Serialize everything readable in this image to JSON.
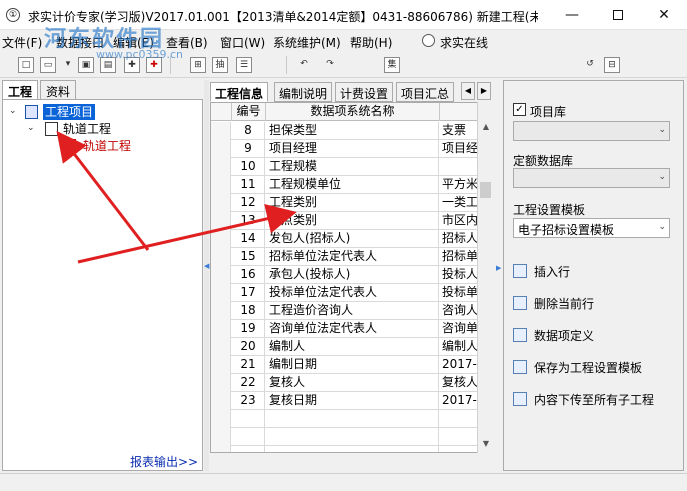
{
  "window": {
    "title": "求实计价专家(学习版)V2017.01.001【2013清单&2014定额】0431-88606786) 新建工程(未...",
    "app_icon": "①"
  },
  "watermark": {
    "text": "河东软件园",
    "url": "www.pc0359.cn"
  },
  "menu": [
    "文件(F)",
    "数据接口",
    "编辑(E)",
    "查看(B)",
    "窗口(W)",
    "系统维护(M)",
    "帮助(H)"
  ],
  "online": {
    "label": "求实在线"
  },
  "toolbar": {
    "b1": "□",
    "b2": "▭",
    "b3": "▾",
    "b4": "▣",
    "b5": "▤",
    "b6": "✚",
    "b7": "⊞",
    "b8": "抽",
    "b9": "☰",
    "b10": "↶",
    "b11": "↷",
    "b12": "集",
    "b13": "↺",
    "b14": "⊟"
  },
  "left_tabs": [
    "工程",
    "资料"
  ],
  "tree": {
    "root": "工程项目",
    "child": "轨道工程",
    "leaf": "轨道工程",
    "toggle_open": "⌄"
  },
  "report_link": "报表输出>>",
  "mid_tabs": [
    "工程信息",
    "编制说明",
    "计费设置",
    "项目汇总"
  ],
  "tab_scroll": {
    "left": "◀",
    "right": "▶"
  },
  "grid": {
    "headers": [
      "编号",
      "数据项系统名称",
      ""
    ],
    "rows": [
      {
        "num": "8",
        "name": "担保类型",
        "val": "支票"
      },
      {
        "num": "9",
        "name": "项目经理",
        "val": "项目经"
      },
      {
        "num": "10",
        "name": "工程规模",
        "val": ""
      },
      {
        "num": "11",
        "name": "工程规模单位",
        "val": "平方米"
      },
      {
        "num": "12",
        "name": "工程类别",
        "val": "一类工"
      },
      {
        "num": "13",
        "name": "地点类别",
        "val": "市区内"
      },
      {
        "num": "14",
        "name": "发包人(招标人)",
        "val": "招标人"
      },
      {
        "num": "15",
        "name": "招标单位法定代表人",
        "val": "招标单"
      },
      {
        "num": "16",
        "name": "承包人(投标人)",
        "val": "投标人"
      },
      {
        "num": "17",
        "name": "投标单位法定代表人",
        "val": "投标单"
      },
      {
        "num": "18",
        "name": "工程造价咨询人",
        "val": "咨询人"
      },
      {
        "num": "19",
        "name": "咨询单位法定代表人",
        "val": "咨询单"
      },
      {
        "num": "20",
        "name": "编制人",
        "val": "编制人"
      },
      {
        "num": "21",
        "name": "编制日期",
        "val": "2017-0"
      },
      {
        "num": "22",
        "name": "复核人",
        "val": "复核人"
      },
      {
        "num": "23",
        "name": "复核日期",
        "val": "2017-0"
      }
    ]
  },
  "scroll": {
    "up": "▲",
    "down": "▼"
  },
  "right": {
    "project_lib_label": "项目库",
    "project_lib_checked": "✓",
    "quota_db_label": "定额数据库",
    "template_label": "工程设置模板",
    "template_value": "电子招标设置模板",
    "combo_arrow": "⌄",
    "actions": [
      "插入行",
      "删除当前行",
      "数据项定义",
      "保存为工程设置模板",
      "内容下传至所有子工程"
    ]
  },
  "splitter": {
    "left": "◀",
    "right": "▶"
  },
  "colors": {
    "selection": "#0a64d8",
    "arrow": "#e02020",
    "leaf_text": "#c00000"
  }
}
